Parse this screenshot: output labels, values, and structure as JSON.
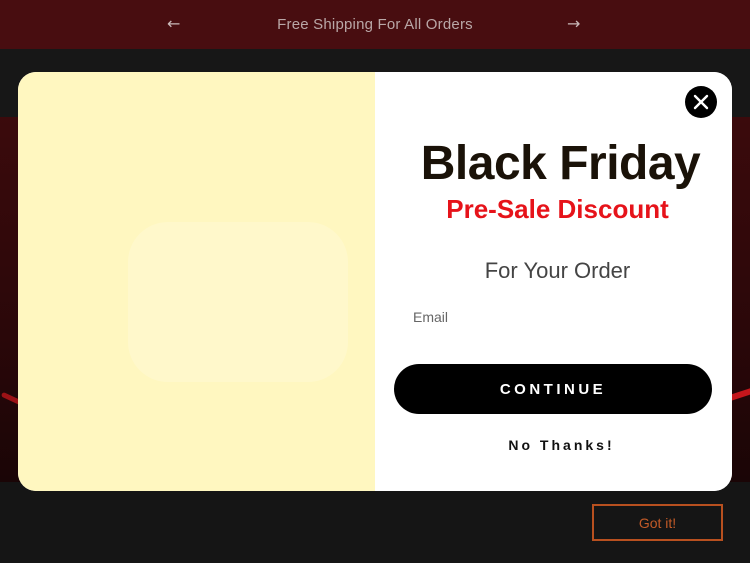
{
  "announcement": {
    "prev_icon": "arrow-left-icon",
    "message": "Free Shipping For All Orders",
    "next_icon": "arrow-right-icon"
  },
  "popup": {
    "headline": "Black Friday",
    "subheadline": "Pre-Sale Discount",
    "order_text": "For Your Order",
    "email_placeholder": "Email",
    "continue_label": "CONTINUE",
    "decline_label": "No Thanks!",
    "close_icon": "close-icon",
    "colors": {
      "headline": "#1a1208",
      "subheadline": "#e6131a",
      "image_panel": "#fff7c0",
      "button": "#000000"
    }
  },
  "cookie_bar": {
    "accept_label": "Got it!"
  },
  "colors": {
    "announcement_bg": "#480d10",
    "accent": "#c25a27"
  }
}
